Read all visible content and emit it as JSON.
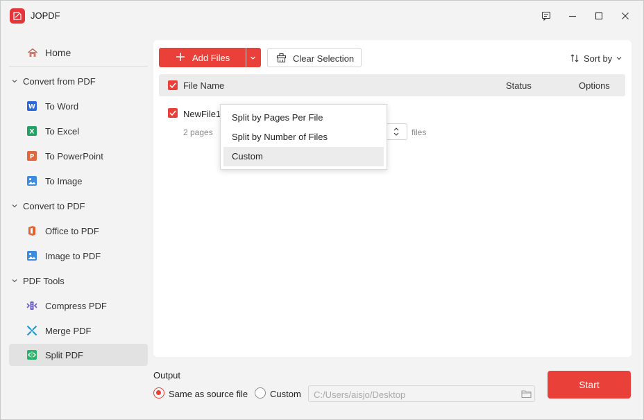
{
  "app": {
    "title": "JOPDF",
    "logo_text": "PDF"
  },
  "window_controls": [
    "feedback-icon",
    "minimize-icon",
    "maximize-icon",
    "close-icon"
  ],
  "sidebar": {
    "home": "Home",
    "groups": [
      {
        "label": "Convert from PDF",
        "items": [
          {
            "label": "To Word",
            "icon": "word-icon",
            "color": "#2b6ad8"
          },
          {
            "label": "To Excel",
            "icon": "excel-icon",
            "color": "#21a366"
          },
          {
            "label": "To PowerPoint",
            "icon": "powerpoint-icon",
            "color": "#e0683a"
          },
          {
            "label": "To Image",
            "icon": "image-icon",
            "color": "#3b8be0"
          }
        ]
      },
      {
        "label": "Convert to PDF",
        "items": [
          {
            "label": "Office to PDF",
            "icon": "office-icon",
            "color": "#e8602c"
          },
          {
            "label": "Image to PDF",
            "icon": "image-icon",
            "color": "#3b8be0"
          }
        ]
      },
      {
        "label": "PDF Tools",
        "items": [
          {
            "label": "Compress PDF",
            "icon": "compress-icon",
            "color": "#6a5fc8"
          },
          {
            "label": "Merge PDF",
            "icon": "merge-icon",
            "color": "#1e9ad6"
          },
          {
            "label": "Split PDF",
            "icon": "split-icon",
            "color": "#27b36a",
            "active": true
          }
        ]
      }
    ]
  },
  "toolbar": {
    "add_files": "Add Files",
    "clear_selection": "Clear Selection",
    "sort_by": "Sort by"
  },
  "table": {
    "headers": {
      "file_name": "File Name",
      "status": "Status",
      "options": "Options"
    },
    "rows": [
      {
        "name": "NewFile1",
        "pages": "2 pages",
        "unit": "files"
      }
    ]
  },
  "dropdown": {
    "options": [
      "Split by Pages Per File",
      "Split by Number of Files",
      "Custom"
    ],
    "highlighted": "Custom"
  },
  "footer": {
    "output_label": "Output",
    "same_as_source": "Same as source file",
    "custom": "Custom",
    "path": "C:/Users/aisjo/Desktop",
    "start": "Start"
  },
  "colors": {
    "accent": "#e9413a"
  }
}
